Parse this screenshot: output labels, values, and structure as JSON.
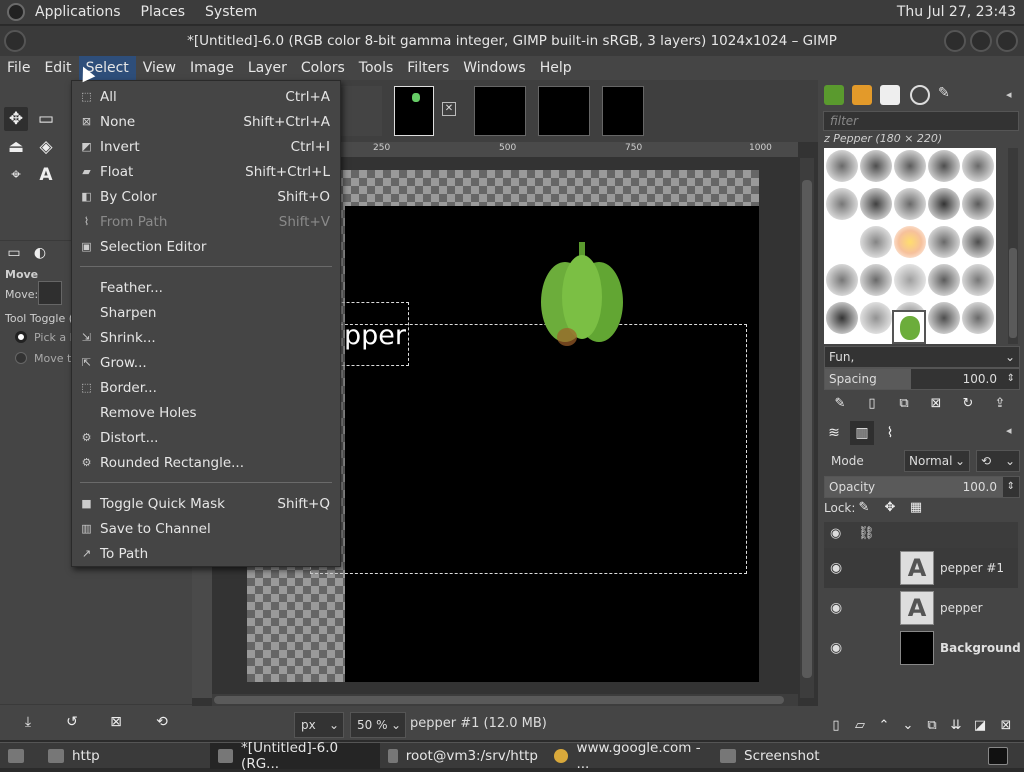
{
  "top_panel": {
    "menus": [
      "Applications",
      "Places",
      "System"
    ],
    "clock": "Thu Jul 27, 23:43"
  },
  "window": {
    "title": "*[Untitled]-6.0 (RGB color 8-bit gamma integer, GIMP built-in sRGB, 3 layers) 1024x1024 – GIMP"
  },
  "menubar": [
    "File",
    "Edit",
    "Select",
    "View",
    "Image",
    "Layer",
    "Colors",
    "Tools",
    "Filters",
    "Windows",
    "Help"
  ],
  "select_menu": {
    "group1": [
      {
        "label": "All",
        "accel": "Ctrl+A",
        "icon": "select-all-icon"
      },
      {
        "label": "None",
        "accel": "Shift+Ctrl+A",
        "icon": "select-none-icon"
      },
      {
        "label": "Invert",
        "accel": "Ctrl+I",
        "icon": "select-invert-icon"
      },
      {
        "label": "Float",
        "accel": "Shift+Ctrl+L",
        "icon": "float-selection-icon"
      },
      {
        "label": "By Color",
        "accel": "Shift+O",
        "icon": "select-by-color-icon"
      },
      {
        "label": "From Path",
        "accel": "Shift+V",
        "icon": "path-to-selection-icon",
        "disabled": true
      },
      {
        "label": "Selection Editor",
        "accel": "",
        "icon": "selection-editor-icon"
      }
    ],
    "group2": [
      {
        "label": "Feather...",
        "accel": ""
      },
      {
        "label": "Sharpen",
        "accel": ""
      },
      {
        "label": "Shrink...",
        "accel": "",
        "icon": "shrink-icon"
      },
      {
        "label": "Grow...",
        "accel": "",
        "icon": "grow-icon"
      },
      {
        "label": "Border...",
        "accel": "",
        "icon": "border-icon"
      },
      {
        "label": "Remove Holes",
        "accel": ""
      },
      {
        "label": "Distort...",
        "accel": "",
        "icon": "distort-icon"
      },
      {
        "label": "Rounded Rectangle...",
        "accel": "",
        "icon": "rounded-rect-icon"
      }
    ],
    "group3": [
      {
        "label": "Toggle Quick Mask",
        "accel": "Shift+Q",
        "icon": "quick-mask-icon"
      },
      {
        "label": "Save to Channel",
        "accel": "",
        "icon": "channel-icon"
      },
      {
        "label": "To Path",
        "accel": "",
        "icon": "to-path-icon"
      }
    ]
  },
  "toolbox": {
    "tool_options_title": "Move",
    "move_label": "Move:",
    "tool_toggle": "Tool Toggle (S",
    "option1": "Pick a l",
    "option2": "Move th"
  },
  "canvas": {
    "ruler_ticks": [
      "250",
      "500",
      "750",
      "1000"
    ],
    "text_layer_visible": "pper"
  },
  "statusbar": {
    "unit": "px",
    "zoom": "50 %",
    "layer_info": "pepper #1 (12.0 MB)"
  },
  "dock": {
    "filter_placeholder": "filter",
    "brush_name": "z Pepper (180 × 220)",
    "brush_tag": "Fun,",
    "spacing_label": "Spacing",
    "spacing_value": "100.0",
    "spacing_fraction": 1.0,
    "mode_label": "Mode",
    "mode_value": "Normal",
    "opacity_label": "Opacity",
    "opacity_value": "100.0",
    "lock_label": "Lock:",
    "layers": [
      {
        "name": "pepper #1",
        "type": "text",
        "active": true
      },
      {
        "name": "pepper",
        "type": "text",
        "active": false
      },
      {
        "name": "Background",
        "type": "image",
        "active": false
      }
    ]
  },
  "taskbar": [
    {
      "label": "http",
      "icon": "folder-icon"
    },
    {
      "label": "*[Untitled]-6.0 (RG...",
      "icon": "gimp-icon",
      "active": true
    },
    {
      "label": "root@vm3:/srv/http",
      "icon": "terminal-icon"
    },
    {
      "label": "www.google.com - ...",
      "icon": "chrome-icon"
    },
    {
      "label": "Screenshot",
      "icon": "screenshot-icon"
    }
  ]
}
